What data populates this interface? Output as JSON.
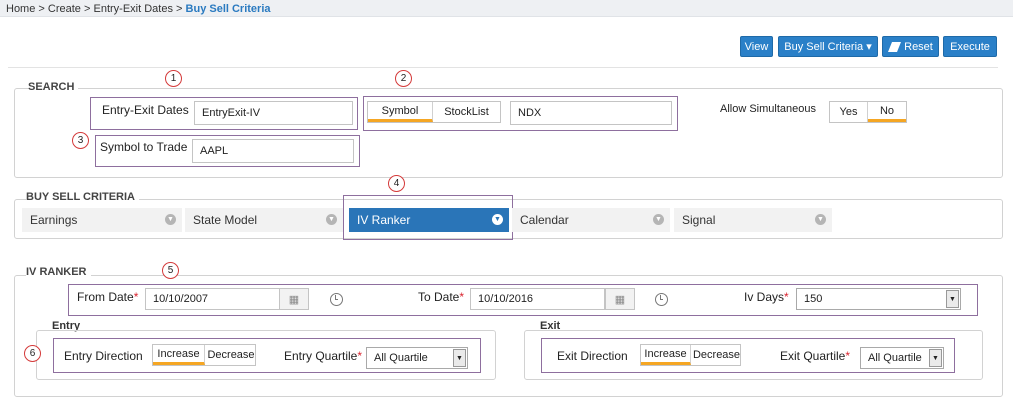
{
  "breadcrumb": {
    "items": [
      "Home",
      "Create",
      "Entry-Exit Dates"
    ],
    "separator": ">",
    "current": "Buy Sell Criteria"
  },
  "toolbar": {
    "view": "View",
    "criteria": "Buy Sell Criteria",
    "criteria_caret": "▾",
    "reset": "Reset",
    "execute": "Execute"
  },
  "search": {
    "legend": "SEARCH",
    "entry_exit_label": "Entry-Exit Dates",
    "entry_exit_value": "EntryExit-IV",
    "symbol_toggle": [
      "Symbol",
      "StockList"
    ],
    "symbol_value": "NDX",
    "allow_label": "Allow Simultaneous",
    "allow_options": [
      "Yes",
      "No"
    ],
    "trade_label": "Symbol to Trade",
    "trade_value": "AAPL"
  },
  "criteria": {
    "legend": "BUY SELL CRITERIA",
    "tabs": [
      "Earnings",
      "State Model",
      "IV Ranker",
      "Calendar",
      "Signal"
    ],
    "active_tab": "IV Ranker"
  },
  "ivranker": {
    "legend": "IV RANKER",
    "from_label": "From Date",
    "from_value": "10/10/2007",
    "to_label": "To Date",
    "to_value": "10/10/2016",
    "ivdays_label": "Iv Days",
    "ivdays_value": "150",
    "required_mark": "*",
    "entry": {
      "title": "Entry",
      "direction_label": "Entry Direction",
      "direction_options": [
        "Increase",
        "Decrease"
      ],
      "quartile_label": "Entry Quartile",
      "quartile_value": "All Quartile"
    },
    "exit": {
      "title": "Exit",
      "direction_label": "Exit Direction",
      "direction_options": [
        "Increase",
        "Decrease"
      ],
      "quartile_label": "Exit Quartile",
      "quartile_value": "All Quartile"
    }
  },
  "markers": [
    "1",
    "2",
    "3",
    "4",
    "5",
    "6"
  ],
  "icons": {
    "calendar": "calendar-icon",
    "clock": "clock-icon",
    "eraser": "eraser-icon",
    "chevron": "chevron-down-icon"
  },
  "colors": {
    "primary": "#2a80c8",
    "active_tab": "#2a75b8",
    "toggle_underline": "#f5a623",
    "annotation": "#8e6f9e",
    "marker": "#d43a3a",
    "required": "#d9232e"
  }
}
